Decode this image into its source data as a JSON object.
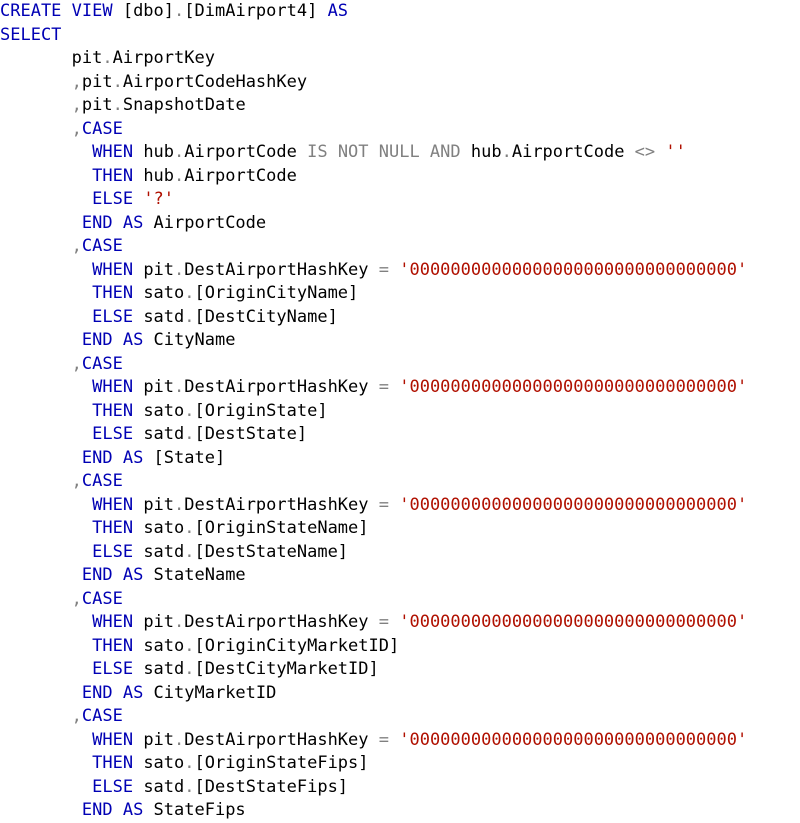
{
  "editor": {
    "language": "T-SQL",
    "colors": {
      "keyword": "#0000b4",
      "identifier": "#000000",
      "operator": "#808080",
      "string": "#b01000"
    },
    "lines": [
      [
        {
          "t": "CREATE VIEW ",
          "c": "kw"
        },
        {
          "t": "[dbo]",
          "c": ""
        },
        {
          "t": ".",
          "c": "gr"
        },
        {
          "t": "[DimAirport4] ",
          "c": ""
        },
        {
          "t": "AS",
          "c": "kw"
        }
      ],
      [
        {
          "t": "SELECT",
          "c": "kw"
        }
      ],
      [
        {
          "t": "       pit",
          "c": ""
        },
        {
          "t": ".",
          "c": "gr"
        },
        {
          "t": "AirportKey",
          "c": ""
        }
      ],
      [
        {
          "t": "       ",
          "c": ""
        },
        {
          "t": ",",
          "c": "gr"
        },
        {
          "t": "pit",
          "c": ""
        },
        {
          "t": ".",
          "c": "gr"
        },
        {
          "t": "AirportCodeHashKey",
          "c": ""
        }
      ],
      [
        {
          "t": "       ",
          "c": ""
        },
        {
          "t": ",",
          "c": "gr"
        },
        {
          "t": "pit",
          "c": ""
        },
        {
          "t": ".",
          "c": "gr"
        },
        {
          "t": "SnapshotDate",
          "c": ""
        }
      ],
      [
        {
          "t": "       ",
          "c": ""
        },
        {
          "t": ",",
          "c": "gr"
        },
        {
          "t": "CASE",
          "c": "kw"
        }
      ],
      [
        {
          "t": "         ",
          "c": ""
        },
        {
          "t": "WHEN ",
          "c": "kw"
        },
        {
          "t": "hub",
          "c": ""
        },
        {
          "t": ".",
          "c": "gr"
        },
        {
          "t": "AirportCode ",
          "c": ""
        },
        {
          "t": "IS NOT NULL AND ",
          "c": "gr"
        },
        {
          "t": "hub",
          "c": ""
        },
        {
          "t": ".",
          "c": "gr"
        },
        {
          "t": "AirportCode ",
          "c": ""
        },
        {
          "t": "<> ",
          "c": "gr"
        },
        {
          "t": "''",
          "c": "str"
        }
      ],
      [
        {
          "t": "         ",
          "c": ""
        },
        {
          "t": "THEN ",
          "c": "kw"
        },
        {
          "t": "hub",
          "c": ""
        },
        {
          "t": ".",
          "c": "gr"
        },
        {
          "t": "AirportCode",
          "c": ""
        }
      ],
      [
        {
          "t": "         ",
          "c": ""
        },
        {
          "t": "ELSE ",
          "c": "kw"
        },
        {
          "t": "'?'",
          "c": "str"
        }
      ],
      [
        {
          "t": "        ",
          "c": ""
        },
        {
          "t": "END AS ",
          "c": "kw"
        },
        {
          "t": "AirportCode",
          "c": ""
        }
      ],
      [
        {
          "t": "       ",
          "c": ""
        },
        {
          "t": ",",
          "c": "gr"
        },
        {
          "t": "CASE",
          "c": "kw"
        }
      ],
      [
        {
          "t": "         ",
          "c": ""
        },
        {
          "t": "WHEN ",
          "c": "kw"
        },
        {
          "t": "pit",
          "c": ""
        },
        {
          "t": ".",
          "c": "gr"
        },
        {
          "t": "DestAirportHashKey ",
          "c": ""
        },
        {
          "t": "= ",
          "c": "gr"
        },
        {
          "t": "'00000000000000000000000000000000'",
          "c": "str"
        }
      ],
      [
        {
          "t": "         ",
          "c": ""
        },
        {
          "t": "THEN ",
          "c": "kw"
        },
        {
          "t": "sato",
          "c": ""
        },
        {
          "t": ".",
          "c": "gr"
        },
        {
          "t": "[OriginCityName]",
          "c": ""
        }
      ],
      [
        {
          "t": "         ",
          "c": ""
        },
        {
          "t": "ELSE ",
          "c": "kw"
        },
        {
          "t": "satd",
          "c": ""
        },
        {
          "t": ".",
          "c": "gr"
        },
        {
          "t": "[DestCityName]",
          "c": ""
        }
      ],
      [
        {
          "t": "        ",
          "c": ""
        },
        {
          "t": "END AS ",
          "c": "kw"
        },
        {
          "t": "CityName",
          "c": ""
        }
      ],
      [
        {
          "t": "       ",
          "c": ""
        },
        {
          "t": ",",
          "c": "gr"
        },
        {
          "t": "CASE",
          "c": "kw"
        }
      ],
      [
        {
          "t": "         ",
          "c": ""
        },
        {
          "t": "WHEN ",
          "c": "kw"
        },
        {
          "t": "pit",
          "c": ""
        },
        {
          "t": ".",
          "c": "gr"
        },
        {
          "t": "DestAirportHashKey ",
          "c": ""
        },
        {
          "t": "= ",
          "c": "gr"
        },
        {
          "t": "'00000000000000000000000000000000'",
          "c": "str"
        }
      ],
      [
        {
          "t": "         ",
          "c": ""
        },
        {
          "t": "THEN ",
          "c": "kw"
        },
        {
          "t": "sato",
          "c": ""
        },
        {
          "t": ".",
          "c": "gr"
        },
        {
          "t": "[OriginState]",
          "c": ""
        }
      ],
      [
        {
          "t": "         ",
          "c": ""
        },
        {
          "t": "ELSE ",
          "c": "kw"
        },
        {
          "t": "satd",
          "c": ""
        },
        {
          "t": ".",
          "c": "gr"
        },
        {
          "t": "[DestState]",
          "c": ""
        }
      ],
      [
        {
          "t": "        ",
          "c": ""
        },
        {
          "t": "END AS ",
          "c": "kw"
        },
        {
          "t": "[State]",
          "c": ""
        }
      ],
      [
        {
          "t": "       ",
          "c": ""
        },
        {
          "t": ",",
          "c": "gr"
        },
        {
          "t": "CASE",
          "c": "kw"
        }
      ],
      [
        {
          "t": "         ",
          "c": ""
        },
        {
          "t": "WHEN ",
          "c": "kw"
        },
        {
          "t": "pit",
          "c": ""
        },
        {
          "t": ".",
          "c": "gr"
        },
        {
          "t": "DestAirportHashKey ",
          "c": ""
        },
        {
          "t": "= ",
          "c": "gr"
        },
        {
          "t": "'00000000000000000000000000000000'",
          "c": "str"
        }
      ],
      [
        {
          "t": "         ",
          "c": ""
        },
        {
          "t": "THEN ",
          "c": "kw"
        },
        {
          "t": "sato",
          "c": ""
        },
        {
          "t": ".",
          "c": "gr"
        },
        {
          "t": "[OriginStateName]",
          "c": ""
        }
      ],
      [
        {
          "t": "         ",
          "c": ""
        },
        {
          "t": "ELSE ",
          "c": "kw"
        },
        {
          "t": "satd",
          "c": ""
        },
        {
          "t": ".",
          "c": "gr"
        },
        {
          "t": "[DestStateName]",
          "c": ""
        }
      ],
      [
        {
          "t": "        ",
          "c": ""
        },
        {
          "t": "END AS ",
          "c": "kw"
        },
        {
          "t": "StateName",
          "c": ""
        }
      ],
      [
        {
          "t": "       ",
          "c": ""
        },
        {
          "t": ",",
          "c": "gr"
        },
        {
          "t": "CASE",
          "c": "kw"
        }
      ],
      [
        {
          "t": "         ",
          "c": ""
        },
        {
          "t": "WHEN ",
          "c": "kw"
        },
        {
          "t": "pit",
          "c": ""
        },
        {
          "t": ".",
          "c": "gr"
        },
        {
          "t": "DestAirportHashKey ",
          "c": ""
        },
        {
          "t": "= ",
          "c": "gr"
        },
        {
          "t": "'00000000000000000000000000000000'",
          "c": "str"
        }
      ],
      [
        {
          "t": "         ",
          "c": ""
        },
        {
          "t": "THEN ",
          "c": "kw"
        },
        {
          "t": "sato",
          "c": ""
        },
        {
          "t": ".",
          "c": "gr"
        },
        {
          "t": "[OriginCityMarketID]",
          "c": ""
        }
      ],
      [
        {
          "t": "         ",
          "c": ""
        },
        {
          "t": "ELSE ",
          "c": "kw"
        },
        {
          "t": "satd",
          "c": ""
        },
        {
          "t": ".",
          "c": "gr"
        },
        {
          "t": "[DestCityMarketID]",
          "c": ""
        }
      ],
      [
        {
          "t": "        ",
          "c": ""
        },
        {
          "t": "END AS ",
          "c": "kw"
        },
        {
          "t": "CityMarketID",
          "c": ""
        }
      ],
      [
        {
          "t": "       ",
          "c": ""
        },
        {
          "t": ",",
          "c": "gr"
        },
        {
          "t": "CASE",
          "c": "kw"
        }
      ],
      [
        {
          "t": "         ",
          "c": ""
        },
        {
          "t": "WHEN ",
          "c": "kw"
        },
        {
          "t": "pit",
          "c": ""
        },
        {
          "t": ".",
          "c": "gr"
        },
        {
          "t": "DestAirportHashKey ",
          "c": ""
        },
        {
          "t": "= ",
          "c": "gr"
        },
        {
          "t": "'00000000000000000000000000000000'",
          "c": "str"
        }
      ],
      [
        {
          "t": "         ",
          "c": ""
        },
        {
          "t": "THEN ",
          "c": "kw"
        },
        {
          "t": "sato",
          "c": ""
        },
        {
          "t": ".",
          "c": "gr"
        },
        {
          "t": "[OriginStateFips]",
          "c": ""
        }
      ],
      [
        {
          "t": "         ",
          "c": ""
        },
        {
          "t": "ELSE ",
          "c": "kw"
        },
        {
          "t": "satd",
          "c": ""
        },
        {
          "t": ".",
          "c": "gr"
        },
        {
          "t": "[DestStateFips]",
          "c": ""
        }
      ],
      [
        {
          "t": "        ",
          "c": ""
        },
        {
          "t": "END AS ",
          "c": "kw"
        },
        {
          "t": "StateFips",
          "c": ""
        }
      ]
    ]
  }
}
